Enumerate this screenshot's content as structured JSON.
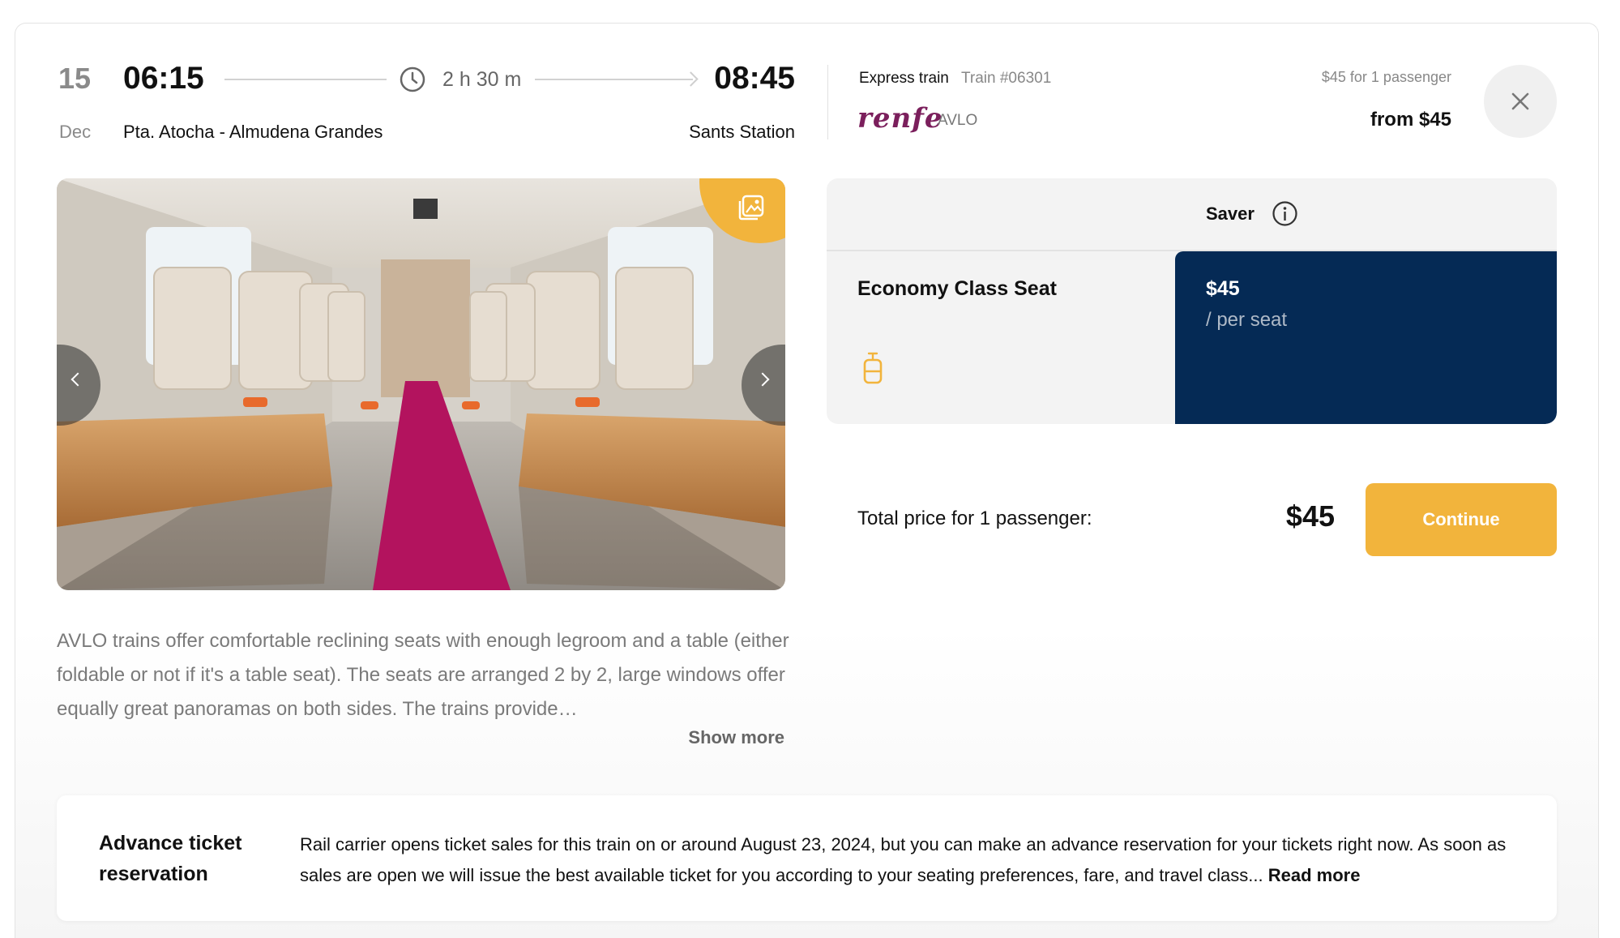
{
  "journey": {
    "date_day": "15",
    "date_month": "Dec",
    "departure_time": "06:15",
    "arrival_time": "08:45",
    "duration": "2 h 30 m",
    "departure_station": "Pta. Atocha - Almudena Grandes",
    "arrival_station": "Sants Station"
  },
  "train": {
    "type": "Express train",
    "number": "Train #06301",
    "carrier_logo": "renfe",
    "service": "AVLO",
    "price_for": "$45 for 1 passenger",
    "from_price": "from $45"
  },
  "gallery": {
    "badge_icon": "gallery-icon",
    "prev_icon": "chevron-left-icon",
    "next_icon": "chevron-right-icon"
  },
  "description": {
    "text": "AVLO trains offer comfortable reclining seats with enough legroom and a table (either foldable or not if it's a table seat). The seats are arranged 2 by 2, large windows offer equally great panoramas on both sides. The trains provide…",
    "show_more": "Show more"
  },
  "fare": {
    "tab_label": "Saver",
    "seat_name": "Economy Class Seat",
    "price": "$45",
    "price_unit": "/ per seat"
  },
  "total": {
    "label": "Total price for 1 passenger:",
    "value": "$45",
    "continue_label": "Continue"
  },
  "advance": {
    "title": "Advance ticket reservation",
    "text": "Rail carrier opens ticket sales for this train on or around August 23, 2024, but you can make an advance reservation for your tickets right now. As soon as sales are open we will issue the best available ticket for you according to your seating preferences, fare, and travel class...",
    "read_more": "Read more"
  },
  "colors": {
    "accent": "#f2b43c",
    "navy": "#052a55",
    "renfe": "#7b1f5c"
  }
}
